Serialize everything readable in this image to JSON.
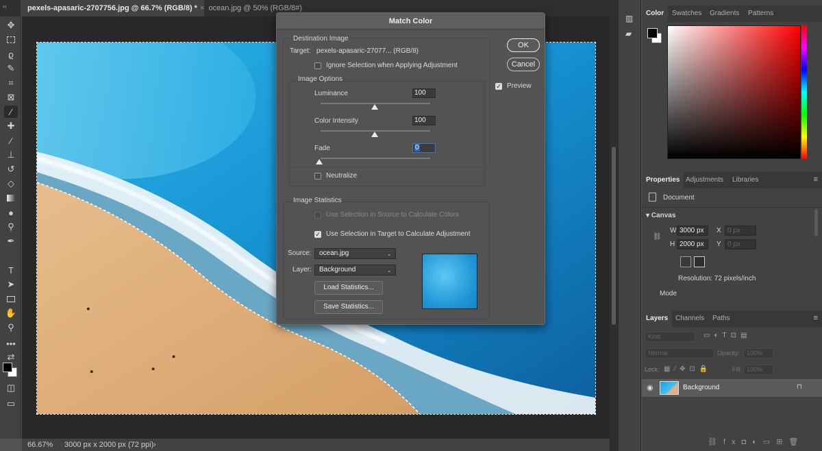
{
  "tabs": [
    {
      "label": "pexels-apasaric-2707756.jpg @ 66.7% (RGB/8) *",
      "active": true
    },
    {
      "label": "ocean.jpg @ 50% (RGB/8#)",
      "active": false
    }
  ],
  "tab_close_glyph": "×",
  "status": {
    "zoom": "66.67%",
    "doc_info": "3000 px x 2000 px (72 ppi)",
    "arrow": "›"
  },
  "dialog": {
    "title": "Match Color",
    "destination": {
      "group_title": "Destination Image",
      "target_label": "Target:",
      "target_value": "pexels-apasaric-27077... (RGB/8)",
      "ignore_selection": {
        "label": "Ignore Selection when Applying Adjustment",
        "checked": false
      }
    },
    "image_options": {
      "group_title": "Image Options",
      "luminance": {
        "label": "Luminance",
        "value": "100"
      },
      "color_intensity": {
        "label": "Color Intensity",
        "value": "100"
      },
      "fade": {
        "label": "Fade",
        "value": "0"
      },
      "neutralize": {
        "label": "Neutralize",
        "checked": false
      }
    },
    "statistics": {
      "group_title": "Image Statistics",
      "use_source": {
        "label": "Use Selection in Source to Calculate Colors",
        "checked": false,
        "enabled": false
      },
      "use_target": {
        "label": "Use Selection in Target to Calculate Adjustment",
        "checked": true
      },
      "source_label": "Source:",
      "source_value": "ocean.jpg",
      "layer_label": "Layer:",
      "layer_value": "Background",
      "load_button": "Load Statistics...",
      "save_button": "Save Statistics..."
    },
    "ok_button": "OK",
    "cancel_button": "Cancel",
    "preview": {
      "label": "Preview",
      "checked": true
    }
  },
  "color_panel": {
    "tabs": [
      "Color",
      "Swatches",
      "Gradients",
      "Patterns"
    ],
    "foreground": "#000000",
    "background": "#ffffff"
  },
  "properties_panel": {
    "tabs": [
      "Properties",
      "Adjustments",
      "Libraries"
    ],
    "document_label": "Document",
    "canvas_label": "Canvas",
    "w_label": "W",
    "w_value": "3000 px",
    "h_label": "H",
    "h_value": "2000 px",
    "x_label": "X",
    "x_value": "0 px",
    "y_label": "Y",
    "y_value": "0 px",
    "resolution": "Resolution: 72 pixels/inch",
    "mode_label": "Mode"
  },
  "layers_panel": {
    "tabs": [
      "Layers",
      "Channels",
      "Paths"
    ],
    "kind_placeholder": "Kind",
    "blend_mode": "Normal",
    "opacity_label": "Opacity:",
    "opacity_value": "100%",
    "lock_label": "Lock:",
    "fill_label": "Fill:",
    "fill_value": "100%",
    "layer_name": "Background"
  },
  "icons": {
    "menu": "≡",
    "checkmark": "✓",
    "caret": "⌄",
    "chevron": "∨",
    "eye": "👁",
    "lock": "🔒",
    "link": "⛓"
  }
}
